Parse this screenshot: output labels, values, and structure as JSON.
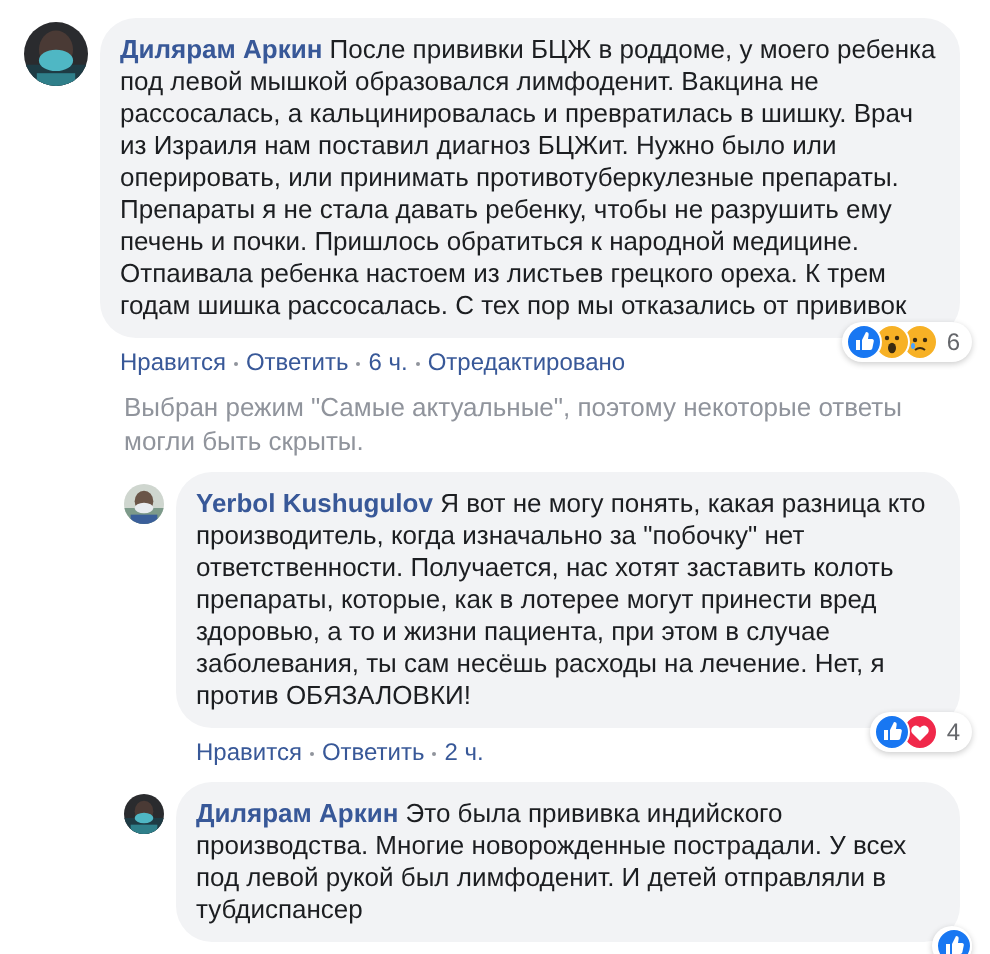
{
  "comments": [
    {
      "author": "Дилярам Аркин",
      "text": "После прививки БЦЖ в роддоме, у моего ребенка под левой мышкой образовался лимфоденит. Вакцина не рассосалась, а кальцинировалась и превратилась в шишку. Врач из Израиля нам поставил диагноз БЦЖит. Нужно было или оперировать, или принимать противотуберкулезные препараты. Препараты я не стала давать ребенку, чтобы не разрушить ему печень и почки. Пришлось обратиться к народной медицине. Отпаивала ребенка настоем из листьев грецкого ореха. К трем годам шишка рассосалась. С тех пор мы отказались от прививок",
      "actions": [
        "Нравится",
        "Ответить"
      ],
      "time": "6 ч.",
      "edited": "Отредактировано",
      "reactions": [
        {
          "kind": "like"
        },
        {
          "kind": "wow"
        },
        {
          "kind": "sad"
        }
      ],
      "reaction_count": "6",
      "replies_notice": "Выбран режим \"Самые актуальные\", поэтому некоторые ответы могли быть скрыты.",
      "replies": [
        {
          "author": "Yerbol Kushugulov",
          "text": "Я вот не могу понять, какая разница кто производитель, когда изначально за \"побочку\" нет ответственности. Получается, нас хотят заставить колоть препараты, которые, как в лотерее могут принести вред здоровью, а то и жизни пациента, при этом в случае заболевания, ты сам несёшь расходы на лечение. Нет, я против ОБЯЗАЛОВКИ!",
          "actions": [
            "Нравится",
            "Ответить"
          ],
          "time": "2 ч.",
          "reactions": [
            {
              "kind": "like"
            },
            {
              "kind": "love"
            }
          ],
          "reaction_count": "4"
        },
        {
          "author": "Дилярам Аркин",
          "text": "Это была прививка индийского производства. Многие новорожденные пострадали. У всех под левой рукой был лимфоденит. И детей отправляли в тубдиспансер",
          "reactions": [
            {
              "kind": "like"
            }
          ]
        }
      ]
    }
  ]
}
